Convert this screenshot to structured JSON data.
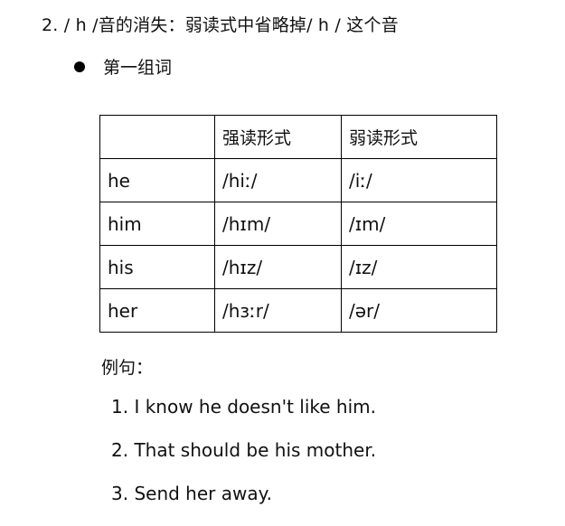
{
  "heading": "2. / h /音的消失：弱读式中省略掉/ h /  这个音",
  "group_title": "第一组词",
  "table": {
    "headers": [
      "",
      "强读形式",
      "弱读形式"
    ],
    "rows": [
      {
        "word": "he",
        "strong": "/hiː/",
        "weak": "/iː/"
      },
      {
        "word": "him",
        "strong": "/hɪm/",
        "weak": "/ɪm/"
      },
      {
        "word": "his",
        "strong": "/hɪz/",
        "weak": "/ɪz/"
      },
      {
        "word": "her",
        "strong": "/hɜːr/",
        "weak": "/ər/"
      }
    ]
  },
  "examples_label": "例句：",
  "examples": [
    "1. I know he doesn't like him.",
    "2. That should be his mother.",
    "3. Send her away."
  ]
}
